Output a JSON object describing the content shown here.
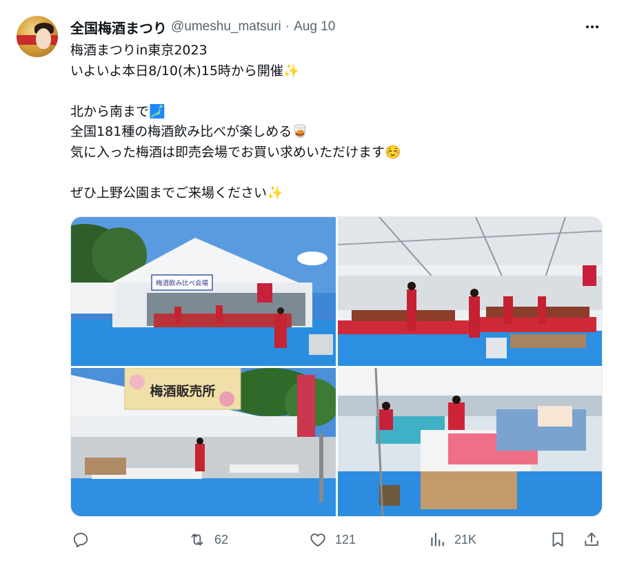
{
  "tweet": {
    "display_name": "全国梅酒まつり",
    "handle": "@umeshu_matsuri",
    "separator": "·",
    "date": "Aug 10",
    "lines": [
      "梅酒まつりin東京2023",
      "いよいよ本日8/10(木)15時から開催✨",
      "",
      "北から南まで🗾",
      "全国181種の梅酒飲み比べが楽しめる🥃",
      "気に入った梅酒は即売会場でお買い求めいただけます☺️",
      "",
      "ぜひ上野公園までご来場ください✨"
    ],
    "photo_signs": {
      "p1_sign": "梅酒飲み比べ会場",
      "p3_sign": "梅酒販売所"
    }
  },
  "actions": {
    "reply": {
      "icon": "reply-icon",
      "count": ""
    },
    "retweet": {
      "icon": "retweet-icon",
      "count": "62"
    },
    "like": {
      "icon": "heart-icon",
      "count": "121"
    },
    "views": {
      "icon": "views-icon",
      "count": "21K"
    },
    "bookmark": {
      "icon": "bookmark-icon"
    },
    "share": {
      "icon": "share-icon"
    }
  },
  "colors": {
    "text": "#0f1419",
    "secondary": "#536471",
    "floor_blue": "#2f8fe3",
    "tent_white": "#eef1f4",
    "banner_red": "#c8203a"
  }
}
